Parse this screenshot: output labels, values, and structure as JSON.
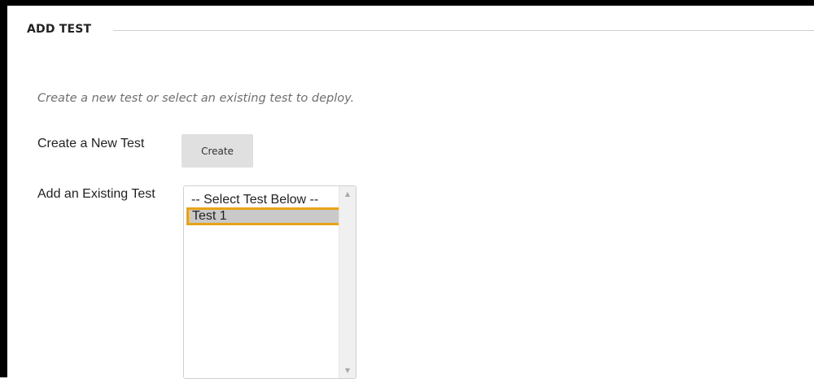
{
  "section": {
    "title": "ADD TEST"
  },
  "instructions": "Create a new test or select an existing test to deploy.",
  "create_row": {
    "label": "Create a New Test",
    "button_label": "Create"
  },
  "existing_row": {
    "label": "Add an Existing Test",
    "options": [
      "-- Select Test Below --",
      "Test 1"
    ],
    "selected_option": "Test 1"
  },
  "colors": {
    "highlight_border": "#e8a317",
    "selected_background": "#c9c9c9",
    "button_background": "#e0e0e0"
  },
  "icons": {
    "scroll_up": "scroll-up-arrow-icon",
    "scroll_down": "scroll-down-arrow-icon"
  }
}
